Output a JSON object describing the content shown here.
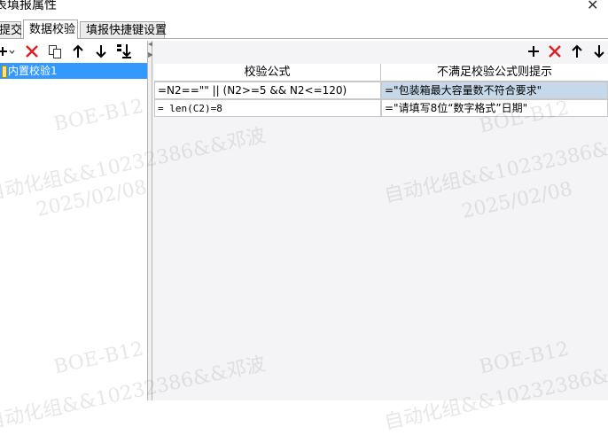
{
  "window": {
    "title": "表填报属性"
  },
  "tabs": [
    {
      "label": "提交"
    },
    {
      "label": "数据校验"
    },
    {
      "label": "填报快捷键设置"
    }
  ],
  "left_list": {
    "items": [
      {
        "label": "内置校验1"
      }
    ]
  },
  "grid": {
    "headers": {
      "formula": "校验公式",
      "message": "不满足校验公式则提示"
    },
    "rows": [
      {
        "formula": "=N2==\"\" || (N2>=5 && N2<=120)",
        "message": "=\"包装箱最大容量数不符合要求\""
      },
      {
        "formula": "= len(C2)=8",
        "message": "=\"请填写8位“数字格式”日期\""
      }
    ]
  },
  "watermark": {
    "line1": "BOE-B12",
    "line2": "自动化组&&10232386&&邓波",
    "line3": "2025/02/08"
  },
  "colors": {
    "selection": "#3399ff",
    "delete": "#e02020",
    "selected_cell": "#c5d9ea"
  }
}
